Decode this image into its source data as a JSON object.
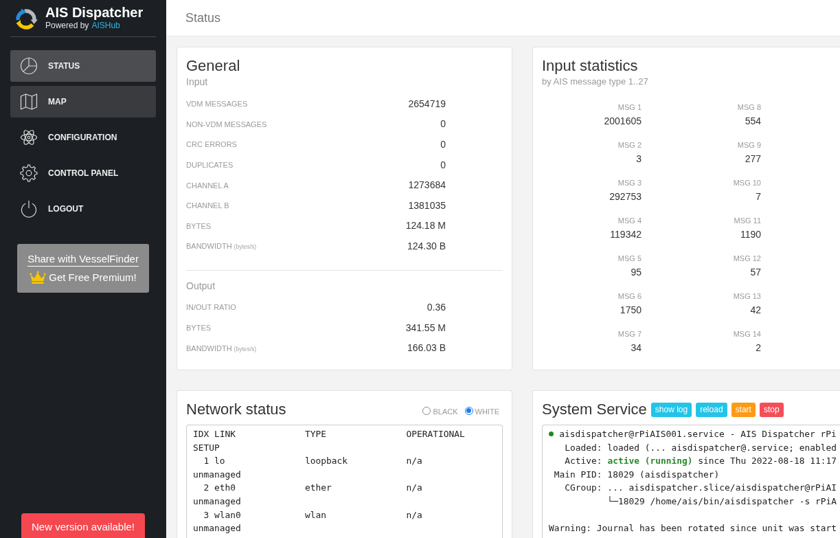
{
  "sidebar": {
    "logo": {
      "title": "AIS Dispatcher",
      "powered_by": "Powered by",
      "link": "AISHub"
    },
    "nav": [
      {
        "label": "STATUS",
        "selected": true,
        "hovered": false
      },
      {
        "label": "MAP",
        "selected": false,
        "hovered": true
      },
      {
        "label": "CONFIGURATION",
        "selected": false,
        "hovered": false
      },
      {
        "label": "CONTROL PANEL",
        "selected": false,
        "hovered": false
      },
      {
        "label": "LOGOUT",
        "selected": false,
        "hovered": false
      }
    ],
    "promo": {
      "link": "Share with VesselFinder",
      "offer": "Get Free Premium!"
    },
    "update_button": "New version available!"
  },
  "header": {
    "title": "Status"
  },
  "general": {
    "title": "General",
    "sections": [
      {
        "heading": "Input",
        "rows": [
          {
            "label": "VDM MESSAGES",
            "value": "2654719"
          },
          {
            "label": "NON-VDM MESSAGES",
            "value": "0"
          },
          {
            "label": "CRC ERRORS",
            "value": "0"
          },
          {
            "label": "DUPLICATES",
            "value": "0"
          },
          {
            "label": "CHANNEL A",
            "value": "1273684"
          },
          {
            "label": "CHANNEL B",
            "value": "1381035"
          },
          {
            "label": "BYTES",
            "value": "124.18 M"
          },
          {
            "label": "BANDWIDTH",
            "unit": "(bytes/s)",
            "value": "124.30 B"
          }
        ]
      },
      {
        "heading": "Output",
        "rows": [
          {
            "label": "IN/OUT RATIO",
            "value": "0.36"
          },
          {
            "label": "BYTES",
            "value": "341.55 M"
          },
          {
            "label": "BANDWIDTH",
            "unit": "(bytes/s)",
            "value": "166.03 B"
          }
        ]
      }
    ]
  },
  "input_statistics": {
    "title": "Input statistics",
    "subtitle": "by AIS message type 1..27",
    "messages": [
      {
        "label": "MSG 1",
        "value": "2001605"
      },
      {
        "label": "MSG 2",
        "value": "3"
      },
      {
        "label": "MSG 3",
        "value": "292753"
      },
      {
        "label": "MSG 4",
        "value": "119342"
      },
      {
        "label": "MSG 5",
        "value": "95"
      },
      {
        "label": "MSG 6",
        "value": "1750"
      },
      {
        "label": "MSG 7",
        "value": "34"
      },
      {
        "label": "MSG 8",
        "value": "554"
      },
      {
        "label": "MSG 9",
        "value": "277"
      },
      {
        "label": "MSG 10",
        "value": "7"
      },
      {
        "label": "MSG 11",
        "value": "1190"
      },
      {
        "label": "MSG 12",
        "value": "57"
      },
      {
        "label": "MSG 13",
        "value": "42"
      },
      {
        "label": "MSG 14",
        "value": "2"
      }
    ]
  },
  "network_status": {
    "title": "Network status",
    "themes": [
      {
        "label": "BLACK",
        "selected": false
      },
      {
        "label": "WHITE",
        "selected": true
      }
    ],
    "output_lines": [
      "IDX LINK             TYPE               OPERATIONAL",
      "SETUP",
      "  1 lo               loopback           n/a",
      "unmanaged",
      "  2 eth0             ether              n/a",
      "unmanaged",
      "  3 wlan0            wlan               n/a",
      "unmanaged"
    ]
  },
  "system_service": {
    "title": "System Service",
    "buttons": [
      {
        "label": "show log",
        "color": "#22c5e8"
      },
      {
        "label": "reload",
        "color": "#22c5e8"
      },
      {
        "label": "start",
        "color": "#fd9a16"
      },
      {
        "label": "stop",
        "color": "#f44e5a"
      }
    ],
    "running": true,
    "status_line": "aisdispatcher@rPiAIS001.service - AIS Dispatcher rPi",
    "lines": [
      "   Loaded: loaded (... aisdispatcher@.service; enabled",
      "   Active: **active (running)** since Thu 2022-08-18 11:17",
      " Main PID: 18029 (aisdispatcher)",
      "   CGroup: ... aisdispatcher.slice/aisdispatcher@rPiAI",
      "           └─18029 /home/ais/bin/aisdispatcher -s rPiA"
    ],
    "warning": "Warning: Journal has been rotated since unit was start"
  }
}
